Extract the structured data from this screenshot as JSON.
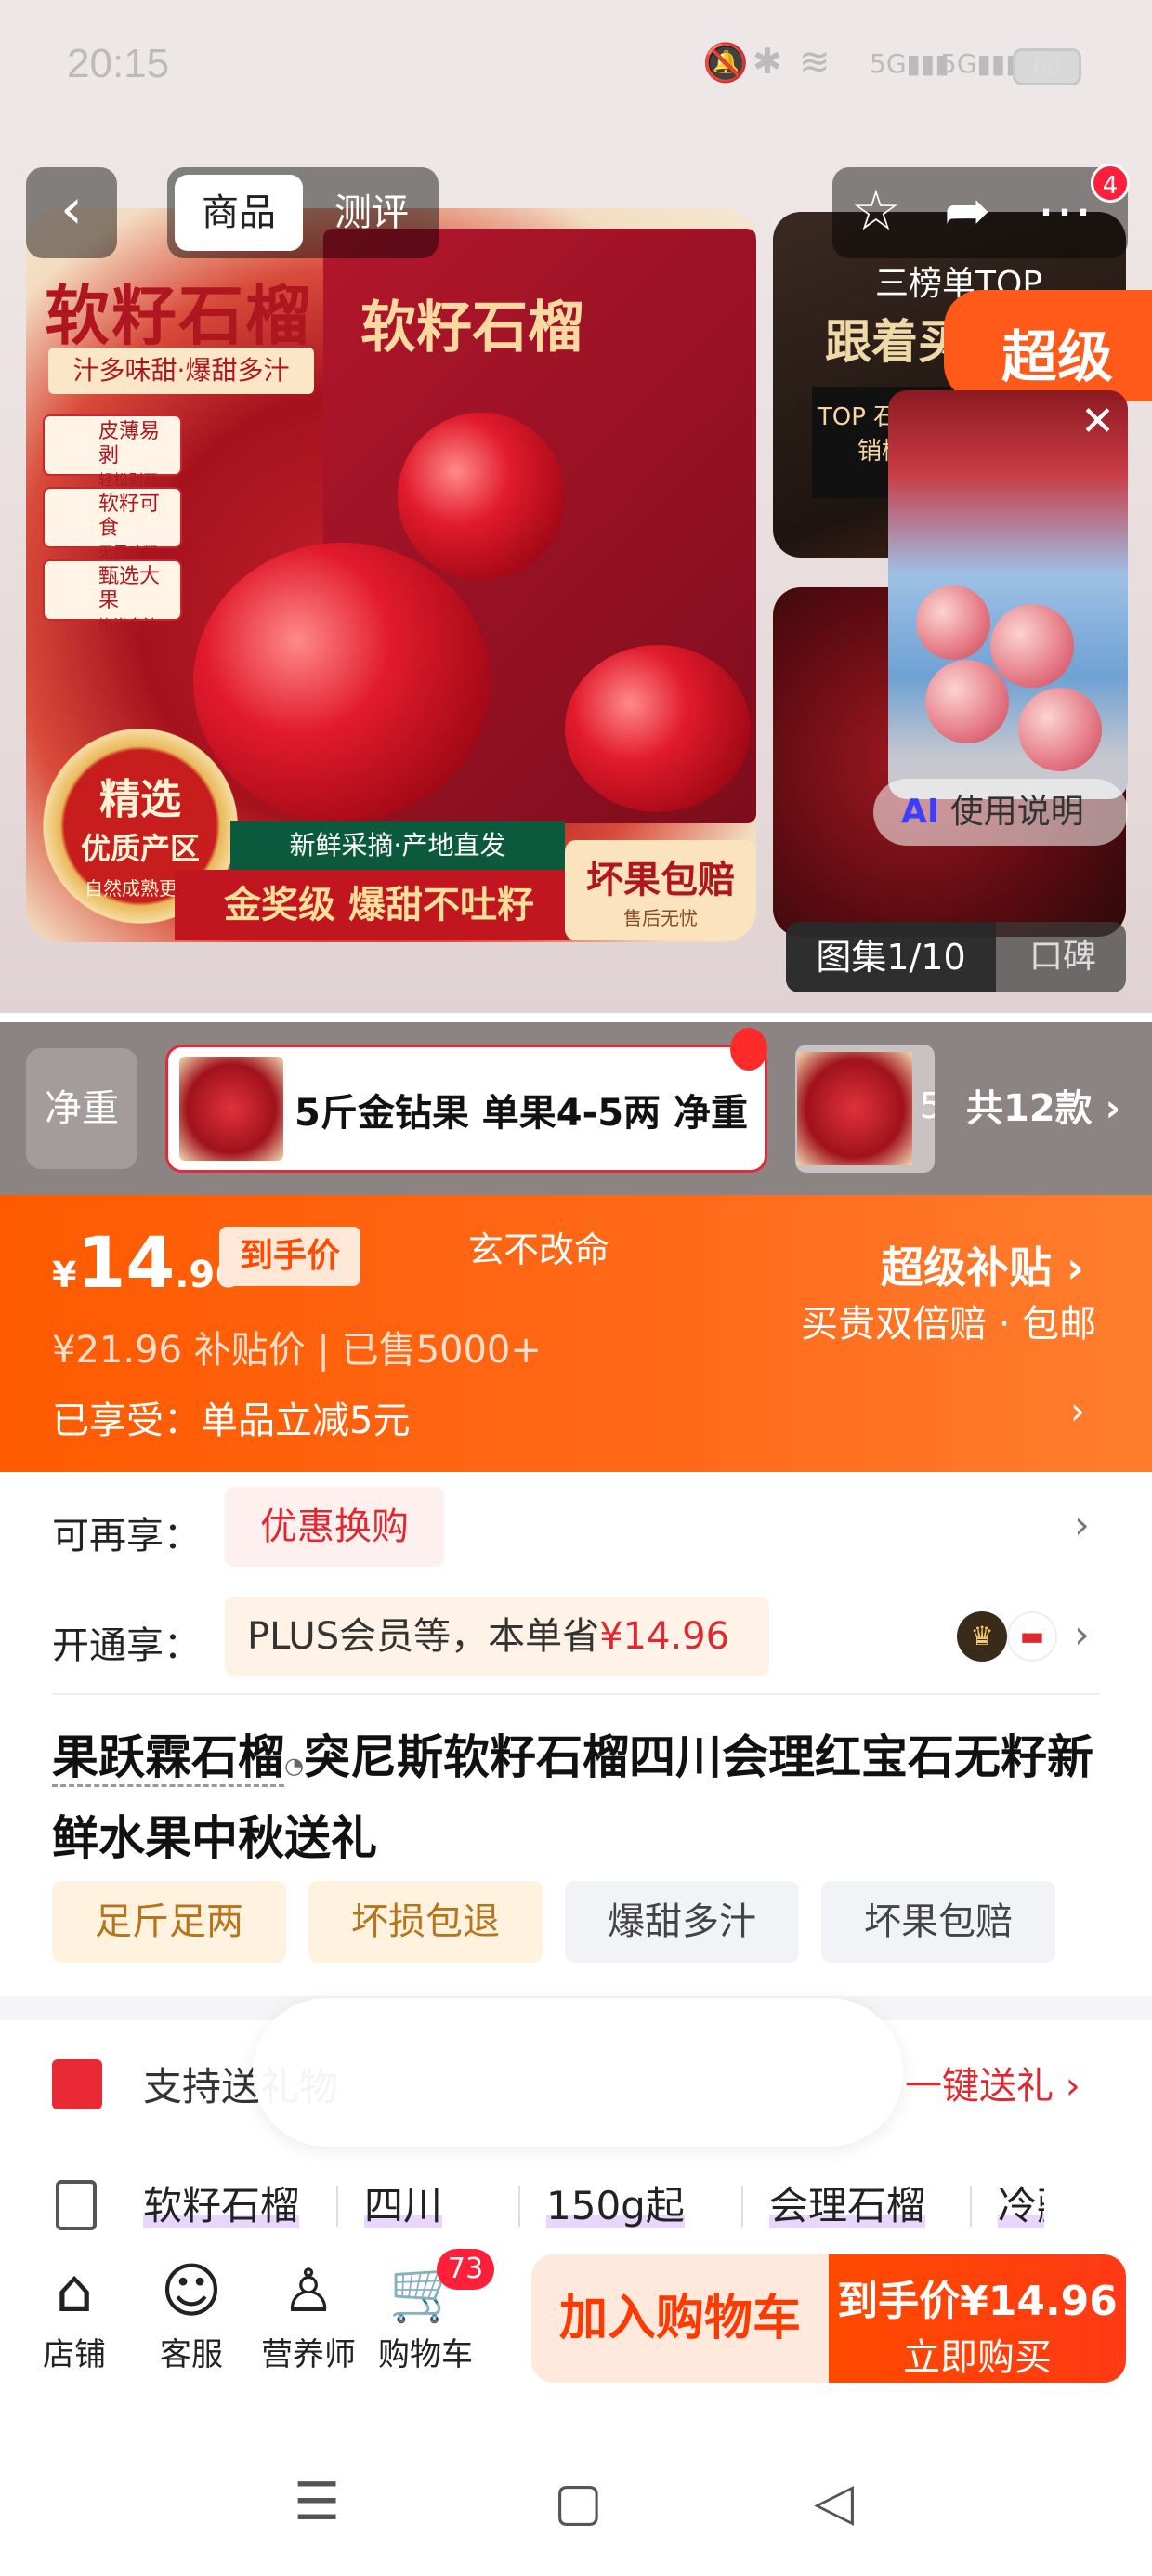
{
  "status": {
    "time": "20:15",
    "battery": "60",
    "net1": "5G",
    "net2": "5G"
  },
  "header": {
    "tabs": [
      "商品",
      "测评"
    ],
    "notification_count": "4"
  },
  "hero": {
    "main_title": "软籽石榴",
    "sub": "汁多味甜·爆甜多汁",
    "features": [
      "皮薄易剥",
      "软籽可食",
      "甄选大果"
    ],
    "features_sub": [
      "轻松剥开",
      "无需吐籽",
      "饱满多汁"
    ],
    "box_title": "软籽石榴",
    "seal": [
      "精选",
      "优质产区",
      "自然成熟更甜"
    ],
    "strip1": "新鲜采摘·产地直发",
    "strip2": "金奖级 爆甜不吐籽",
    "strip3": [
      "坏果包赔",
      "售后无忧"
    ],
    "thumb1": {
      "line1": "三榜单TOP",
      "line2": "跟着买",
      "badge": "TOP 石榴热销榜"
    },
    "super_label": "超级",
    "ai_label_ai": "AI",
    "ai_label_text": "使用说明",
    "gallery": {
      "active": "图集1/10",
      "other": "口碑"
    }
  },
  "variants": {
    "label": "净重",
    "selected": "5斤金钻果 单果4-5两 净重",
    "next_text": "5",
    "count": "共12款 ›"
  },
  "price": {
    "symbol": "¥",
    "int": "14",
    "dec": ".96",
    "tag": "到手价",
    "motto": "玄不改命",
    "super": "超级补贴 ›",
    "super_sub": "买贵双倍赔 · 包邮",
    "original": "¥21.96  补贴价 | 已售5000+",
    "enjoyed": "已享受：单品立减5元"
  },
  "rows": {
    "r1_label": "可再享：",
    "r1_tag": "优惠换购",
    "r2_label": "开通享：",
    "r2_text": "PLUS会员等，本单省",
    "r2_amount": "¥14.96"
  },
  "product": {
    "brand": "果跃霖石榴",
    "title": "突尼斯软籽石榴四川会理红宝石无籽新鲜水果中秋送礼",
    "chips": [
      "足斤足两",
      "坏损包退",
      "爆甜多汁",
      "坏果包赔"
    ]
  },
  "gift": {
    "text": "支持送礼物",
    "link": "一键送礼 ›"
  },
  "specs": [
    "软籽石榴",
    "四川",
    "150g起",
    "会理石榴",
    "冷藏"
  ],
  "bottom": {
    "tabs": [
      "店铺",
      "客服",
      "营养师",
      "购物车"
    ],
    "cart_count": "73",
    "add_cart": "加入购物车",
    "buy_price": "到手价¥14.96",
    "buy_now": "立即购买"
  },
  "colors": {
    "accent": "#ff5a00",
    "red": "#e0282e"
  }
}
